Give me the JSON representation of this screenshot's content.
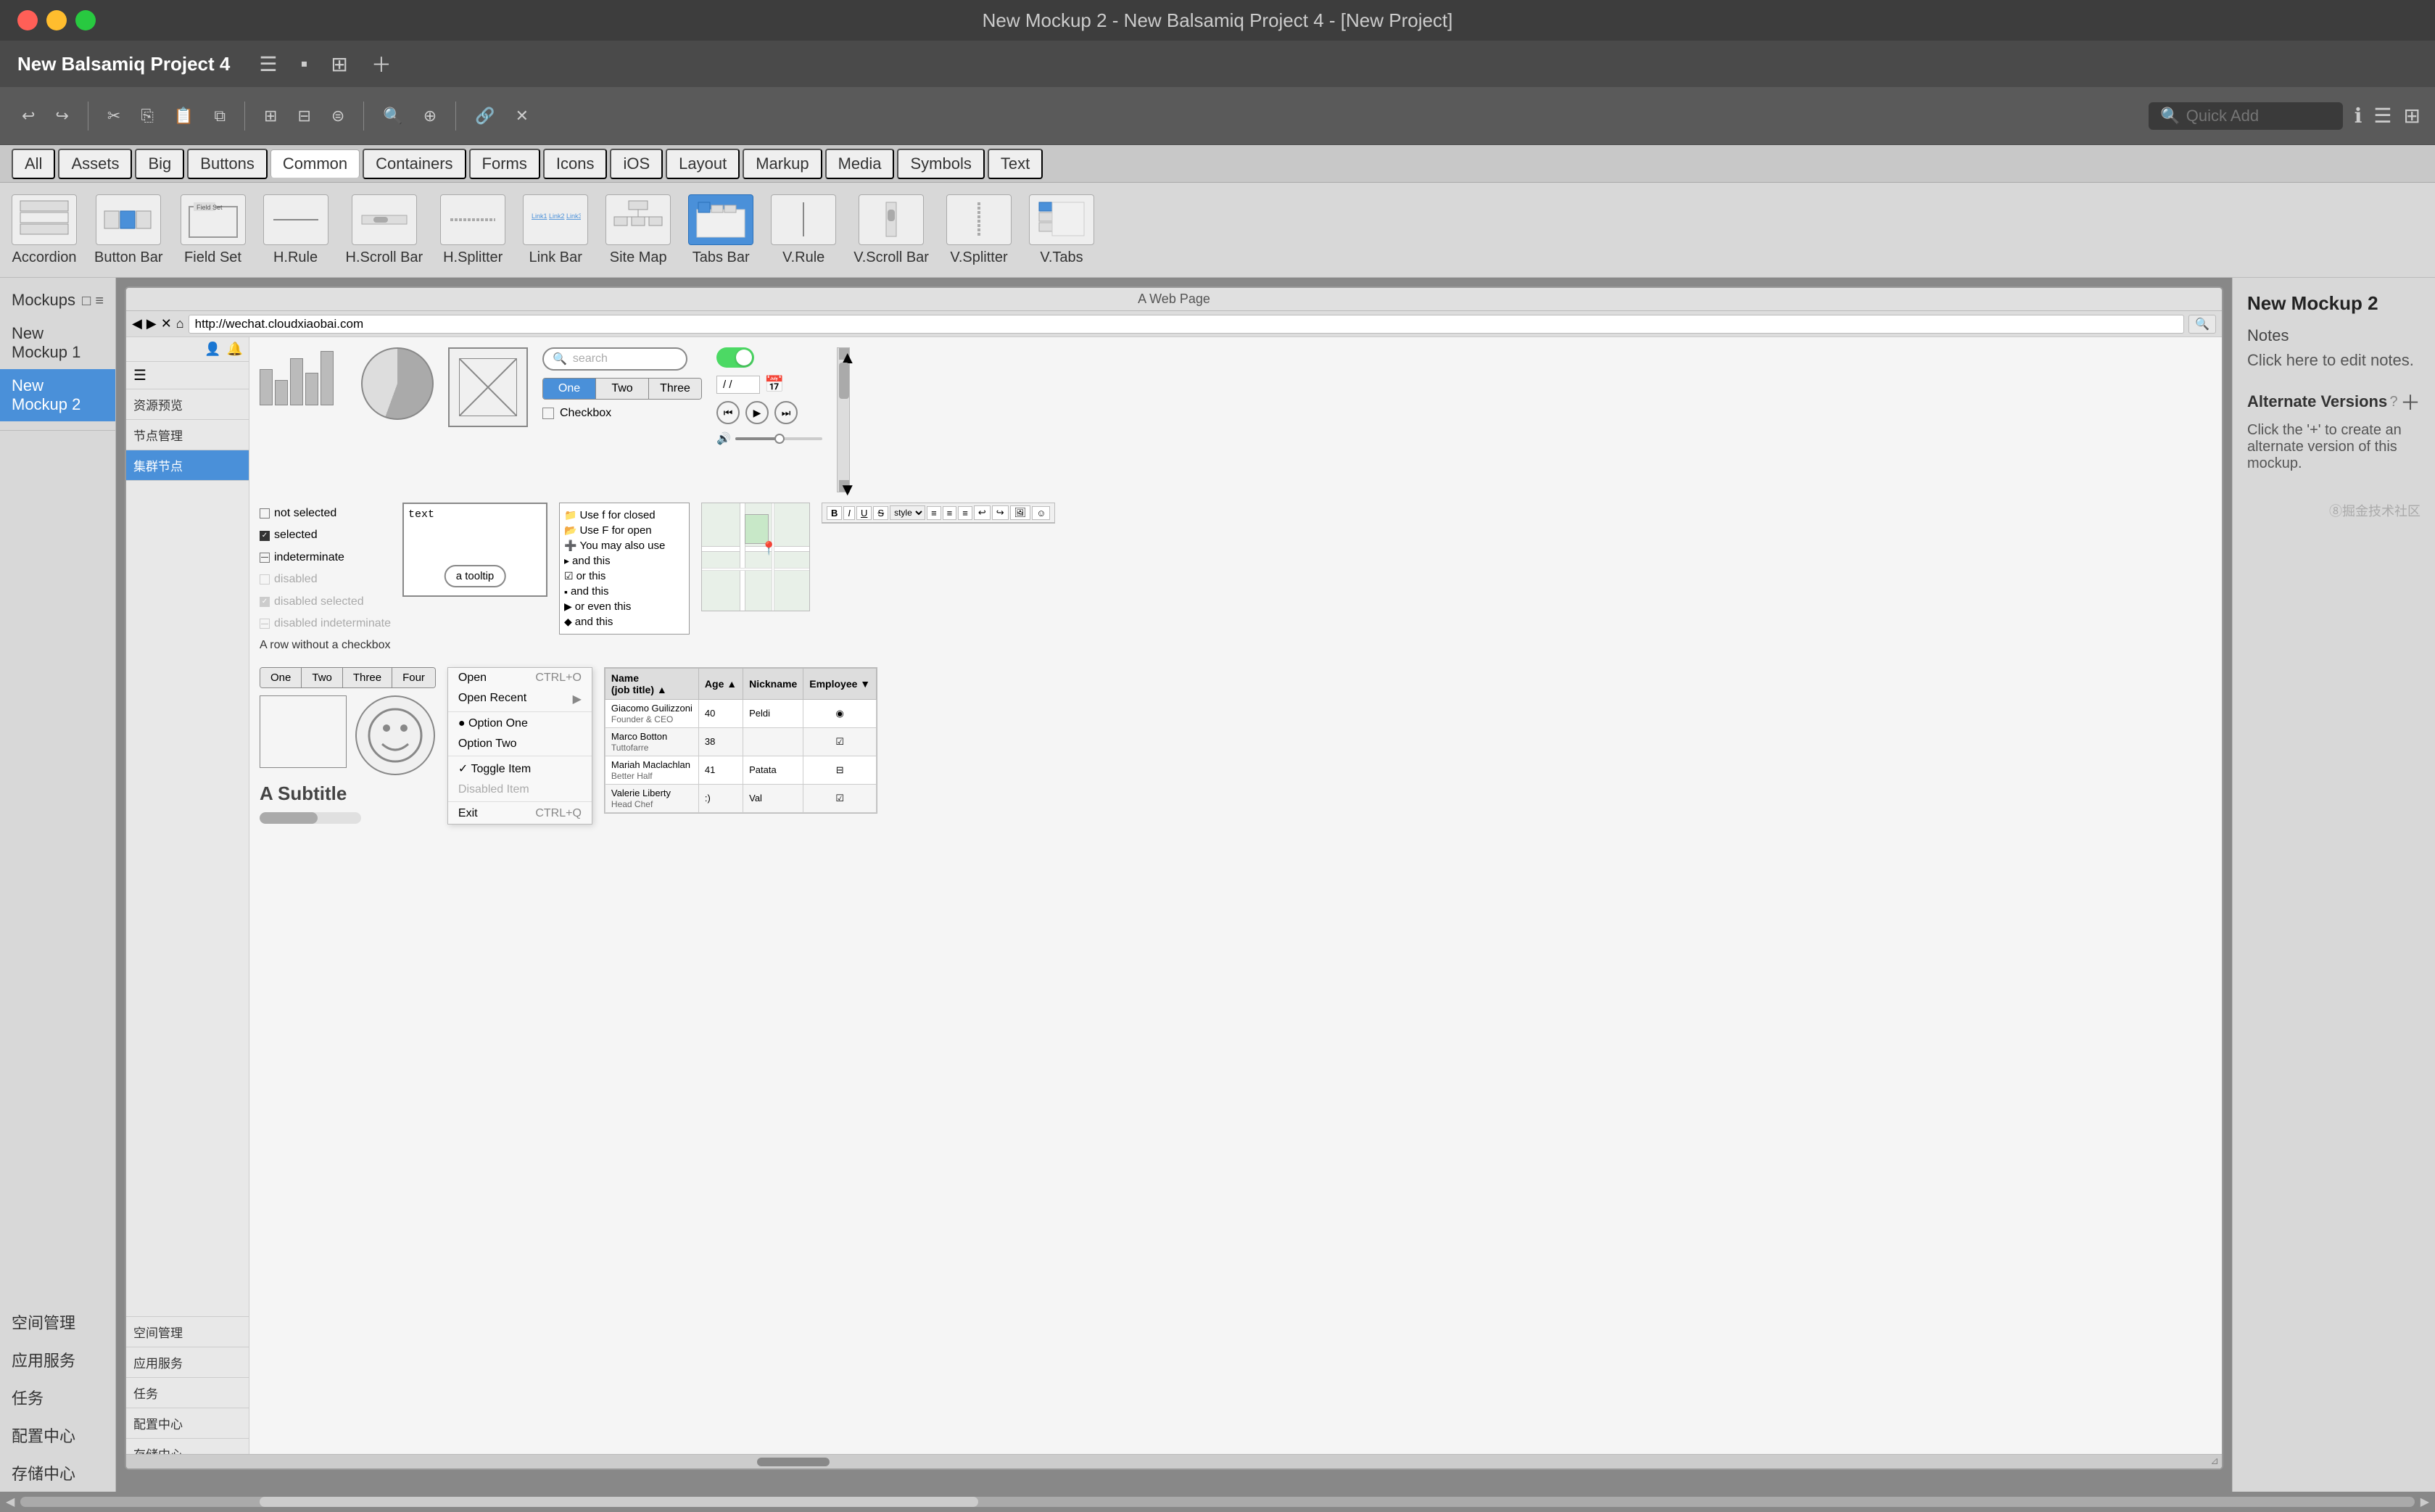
{
  "window": {
    "title": "New Mockup 2 - New Balsamiq Project 4 - [New Project]"
  },
  "app": {
    "name": "New Balsamiq Project 4"
  },
  "toolbar": {
    "quick_add_placeholder": "Quick Add",
    "quick_add_label": "Quick Add"
  },
  "palette": {
    "tabs": [
      "All",
      "Assets",
      "Big",
      "Buttons",
      "Common",
      "Containers",
      "Forms",
      "Icons",
      "iOS",
      "Layout",
      "Markup",
      "Media",
      "Symbols",
      "Text"
    ],
    "active_tab": "Common",
    "items": [
      {
        "label": "Accordion",
        "icon": "accordion"
      },
      {
        "label": "Button Bar",
        "icon": "button-bar"
      },
      {
        "label": "Field Set",
        "icon": "field-set"
      },
      {
        "label": "H.Rule",
        "icon": "h-rule"
      },
      {
        "label": "H.Scroll Bar",
        "icon": "h-scroll-bar"
      },
      {
        "label": "H.Splitter",
        "icon": "h-splitter"
      },
      {
        "label": "Link Bar",
        "icon": "link-bar"
      },
      {
        "label": "Site Map",
        "icon": "site-map"
      },
      {
        "label": "Tabs Bar",
        "icon": "tabs-bar"
      },
      {
        "label": "V.Rule",
        "icon": "v-rule"
      },
      {
        "label": "V.Scroll Bar",
        "icon": "v-scroll-bar"
      },
      {
        "label": "V.Splitter",
        "icon": "v-splitter"
      },
      {
        "label": "V.Tabs",
        "icon": "v-tabs"
      }
    ]
  },
  "left_sidebar": {
    "title": "Mockups",
    "items": [
      {
        "label": "New Mockup 1",
        "active": false
      },
      {
        "label": "New Mockup 2",
        "active": true
      }
    ]
  },
  "browser": {
    "title": "A Web Page",
    "url": "http://wechat.cloudxiaobai.com",
    "nav_items": [
      {
        "label": "资源预览",
        "active": false
      },
      {
        "label": "节点管理",
        "active": false
      },
      {
        "label": "集群节点",
        "active": true
      },
      {
        "label": "空间管理",
        "active": false
      },
      {
        "label": "应用服务",
        "active": false
      },
      {
        "label": "任务",
        "active": false
      },
      {
        "label": "配置中心",
        "active": false
      },
      {
        "label": "存储中心",
        "active": false
      }
    ]
  },
  "mockup": {
    "search_placeholder": "search",
    "tabs_bar": [
      "One",
      "Two",
      "Three"
    ],
    "tabs_bar_active": "One",
    "tabs_bar2": [
      "One",
      "Two",
      "Three",
      "Four"
    ],
    "checkbox_items": [
      {
        "label": "not selected",
        "state": "unchecked",
        "disabled": false
      },
      {
        "label": "selected",
        "state": "checked",
        "disabled": false
      },
      {
        "label": "indeterminate",
        "state": "indeterminate",
        "disabled": false
      },
      {
        "label": "disabled",
        "state": "unchecked",
        "disabled": true
      },
      {
        "label": "disabled selected",
        "state": "checked",
        "disabled": true
      },
      {
        "label": "disabled indeterminate",
        "state": "indeterminate",
        "disabled": true
      },
      {
        "label": "A row without a checkbox",
        "state": "none",
        "disabled": false
      }
    ],
    "tooltip_text": "a tooltip",
    "textarea_placeholder": "text",
    "subtitle": "A Subtitle",
    "context_menu": {
      "items": [
        {
          "label": "Open",
          "shortcut": "CTRL+O",
          "type": "normal"
        },
        {
          "label": "Open Recent",
          "shortcut": "▶",
          "type": "sub"
        },
        {
          "type": "sep"
        },
        {
          "label": "● Option One",
          "type": "radio"
        },
        {
          "label": "Option Two",
          "type": "radio"
        },
        {
          "type": "sep"
        },
        {
          "label": "✓ Toggle Item",
          "type": "toggle"
        },
        {
          "label": "Disabled Item",
          "type": "disabled"
        },
        {
          "type": "sep"
        },
        {
          "label": "Exit",
          "shortcut": "CTRL+Q",
          "type": "normal"
        }
      ]
    },
    "data_grid": {
      "columns": [
        "Name\n(job title)",
        "Age ▲",
        "Nickname",
        "Employee ▼"
      ],
      "rows": [
        [
          "Giacomo Guilizzoni\nFounder & CEO",
          "40",
          "Peldi",
          "◉"
        ],
        [
          "Marco Botton\nTuttoffare",
          "38",
          "",
          "☑"
        ],
        [
          "Mariah Maclachlan\nBetter Half",
          "41",
          "Patata",
          "⊟"
        ],
        [
          "Valerie Liberty\nHead Chef",
          ":)",
          "Val",
          "☑"
        ]
      ]
    },
    "rich_text_tools": [
      "B",
      "I",
      "U",
      "S̶",
      "style▾",
      "≡",
      "≡",
      "≡",
      "↩",
      "↪",
      "🖼",
      "😊"
    ],
    "checkbox_list2": [
      {
        "label": "Use f for closed",
        "checked": false,
        "type": "folder-closed"
      },
      {
        "label": "Use F for open",
        "checked": false,
        "type": "folder-open"
      },
      {
        "label": "You may also use",
        "checked": false,
        "type": "expand"
      },
      {
        "label": "and this",
        "checked": false,
        "type": "item"
      },
      {
        "label": "or this",
        "checked": true,
        "type": "check"
      },
      {
        "label": "and this",
        "checked": false,
        "type": "item2"
      },
      {
        "label": "or even this",
        "checked": false,
        "type": "arrow"
      },
      {
        "label": "and this",
        "checked": false,
        "type": "arrow2"
      }
    ]
  },
  "right_panel": {
    "title": "New Mockup 2",
    "notes_label": "Notes",
    "notes_placeholder": "Click here to edit notes.",
    "alternate_label": "Alternate Versions",
    "alternate_help": "?",
    "alternate_desc": "Click the '+' to create an alternate version of this mockup.",
    "watermark": "⑧掘金技术社区"
  }
}
